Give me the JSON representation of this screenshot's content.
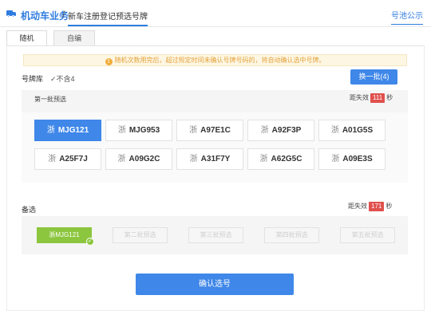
{
  "header": {
    "brand": "机动车业务",
    "separator": "/",
    "current_page": "新车注册登记预选号牌",
    "pool_link": "号池公示",
    "brand_icon": "truck-icon"
  },
  "tabs": [
    {
      "label": "随机",
      "active": true
    },
    {
      "label": "自编",
      "active": false
    }
  ],
  "notice": {
    "icon": "!",
    "text": "随机次数用完后，超过规定时间未确认号牌号码的，将自动确认选中号牌。"
  },
  "library": {
    "label": "号牌库",
    "check_mark": "✓",
    "exclude_option": "不含4",
    "change_button": "换一批(4)"
  },
  "batch": {
    "title": "第一批预选",
    "timer_prefix": "距失效",
    "timer_value": "111",
    "timer_unit": "秒",
    "plates": [
      {
        "prov": "浙",
        "number": "MJG121",
        "selected": true
      },
      {
        "prov": "浙",
        "number": "MJG953",
        "selected": false
      },
      {
        "prov": "浙",
        "number": "A97E1C",
        "selected": false
      },
      {
        "prov": "浙",
        "number": "A92F3P",
        "selected": false
      },
      {
        "prov": "浙",
        "number": "A01G5S",
        "selected": false
      },
      {
        "prov": "浙",
        "number": "A25F7J",
        "selected": false
      },
      {
        "prov": "浙",
        "number": "A09G2C",
        "selected": false
      },
      {
        "prov": "浙",
        "number": "A31F7Y",
        "selected": false
      },
      {
        "prov": "浙",
        "number": "A62G5C",
        "selected": false
      },
      {
        "prov": "浙",
        "number": "A09E3S",
        "selected": false
      }
    ]
  },
  "alternates": {
    "label": "备选",
    "timer_prefix": "距失效",
    "timer_value": "171",
    "timer_unit": "秒",
    "slots": [
      {
        "label": "浙MJG121",
        "filled": true,
        "check": "✓"
      },
      {
        "label": "第二批预选",
        "filled": false
      },
      {
        "label": "第三批预选",
        "filled": false
      },
      {
        "label": "第四批预选",
        "filled": false
      },
      {
        "label": "第五批预选",
        "filled": false
      }
    ]
  },
  "confirm_button": "确认选号",
  "colors": {
    "primary": "#3f87e8",
    "timer": "#e0504d",
    "notice_text": "#e3a33b",
    "selected_slot": "#8cc63f"
  }
}
